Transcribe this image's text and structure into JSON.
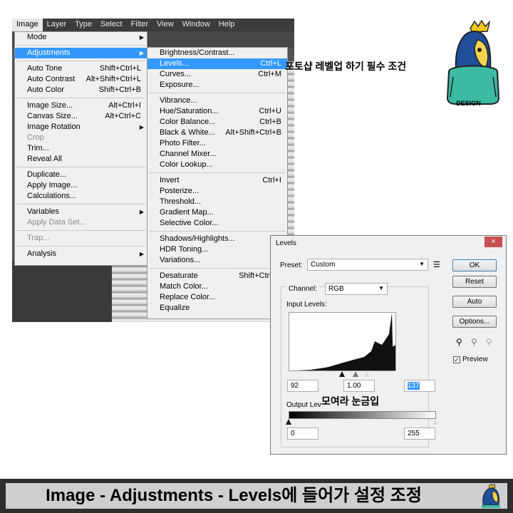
{
  "menubar": {
    "items": [
      "Image",
      "Layer",
      "Type",
      "Select",
      "Filter",
      "View",
      "Window",
      "Help"
    ],
    "active": "Image"
  },
  "image_menu": {
    "mode": "Mode",
    "adjustments": "Adjustments",
    "auto_tone": {
      "label": "Auto Tone",
      "shortcut": "Shift+Ctrl+L"
    },
    "auto_contrast": {
      "label": "Auto Contrast",
      "shortcut": "Alt+Shift+Ctrl+L"
    },
    "auto_color": {
      "label": "Auto Color",
      "shortcut": "Shift+Ctrl+B"
    },
    "image_size": {
      "label": "Image Size...",
      "shortcut": "Alt+Ctrl+I"
    },
    "canvas_size": {
      "label": "Canvas Size...",
      "shortcut": "Alt+Ctrl+C"
    },
    "image_rotation": "Image Rotation",
    "crop": "Crop",
    "trim": "Trim...",
    "reveal_all": "Reveal All",
    "duplicate": "Duplicate...",
    "apply_image": "Apply Image...",
    "calculations": "Calculations...",
    "variables": "Variables",
    "apply_data_set": "Apply Data Set...",
    "trap": "Trap...",
    "analysis": "Analysis"
  },
  "adjust_menu": {
    "brightness": "Brightness/Contrast...",
    "levels": {
      "label": "Levels...",
      "shortcut": "Ctrl+L"
    },
    "curves": {
      "label": "Curves...",
      "shortcut": "Ctrl+M"
    },
    "exposure": "Exposure...",
    "vibrance": "Vibrance...",
    "hue_sat": {
      "label": "Hue/Saturation...",
      "shortcut": "Ctrl+U"
    },
    "color_balance": {
      "label": "Color Balance...",
      "shortcut": "Ctrl+B"
    },
    "black_white": {
      "label": "Black & White...",
      "shortcut": "Alt+Shift+Ctrl+B"
    },
    "photo_filter": "Photo Filter...",
    "channel_mixer": "Channel Mixer...",
    "color_lookup": "Color Lookup...",
    "invert": {
      "label": "Invert",
      "shortcut": "Ctrl+I"
    },
    "posterize": "Posterize...",
    "threshold": "Threshold...",
    "gradient_map": "Gradient Map...",
    "selective_color": "Selective Color...",
    "shadows": "Shadows/Highlights...",
    "hdr_toning": "HDR Toning...",
    "variations": "Variations...",
    "desaturate": {
      "label": "Desaturate",
      "shortcut": "Shift+Ctrl+U"
    },
    "match_color": "Match Color...",
    "replace_color": "Replace Color...",
    "equalize": "Equalize"
  },
  "levels_dialog": {
    "title": "Levels",
    "close": "×",
    "preset_label": "Preset:",
    "preset_value": "Custom",
    "channel_label": "Channel:",
    "channel_value": "RGB",
    "input_levels_label": "Input Levels:",
    "input_black": "92",
    "input_gamma": "1.00",
    "input_white": "137",
    "output_levels_label": "Output Levels:",
    "output_black": "0",
    "output_white": "255",
    "ok": "OK",
    "reset": "Reset",
    "auto": "Auto",
    "options": "Options...",
    "preview_label": "Preview",
    "preview_checked": true
  },
  "annotations": {
    "top_note": "포토샵 레벨업 하기 필수 조건",
    "mid_note": "모여라 눈금입",
    "logo_label": "DESIGN"
  },
  "caption": {
    "text": "Image - Adjustments - Levels에 들어가 설정 조정"
  },
  "colors": {
    "highlight": "#3399ff",
    "menu_bg": "#f0f0f0",
    "ps_dark": "#535353",
    "mascot_body": "#3dbaa3",
    "mascot_head": "#1f4f9a",
    "crown": "#f2c81c"
  }
}
